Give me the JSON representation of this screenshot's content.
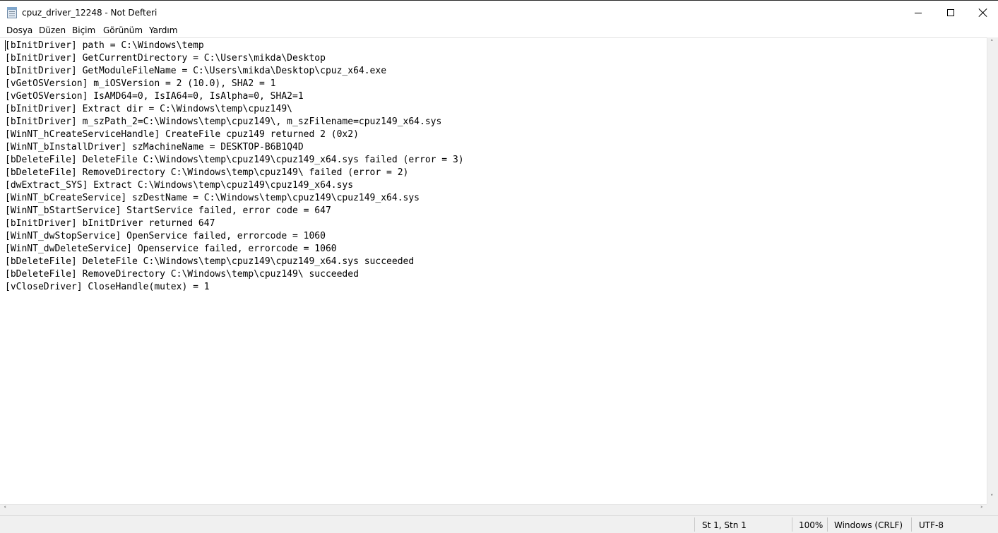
{
  "window": {
    "title": "cpuz_driver_12248 - Not Defteri",
    "app_icon": "notepad-icon"
  },
  "menu": [
    "Dosya",
    "Düzen",
    "Biçim",
    "Görünüm",
    "Yardım"
  ],
  "editor": {
    "lines": [
      "[bInitDriver] path = C:\\Windows\\temp",
      "[bInitDriver] GetCurrentDirectory = C:\\Users\\mikda\\Desktop",
      "[bInitDriver] GetModuleFileName = C:\\Users\\mikda\\Desktop\\cpuz_x64.exe",
      "[vGetOSVersion] m_iOSVersion = 2 (10.0), SHA2 = 1",
      "[vGetOSVersion] IsAMD64=0, IsIA64=0, IsAlpha=0, SHA2=1",
      "[bInitDriver] Extract dir = C:\\Windows\\temp\\cpuz149\\",
      "[bInitDriver] m_szPath_2=C:\\Windows\\temp\\cpuz149\\, m_szFilename=cpuz149_x64.sys",
      "[WinNT_hCreateServiceHandle] CreateFile cpuz149 returned 2 (0x2)",
      "[WinNT_bInstallDriver] szMachineName = DESKTOP-B6B1Q4D",
      "[bDeleteFile] DeleteFile C:\\Windows\\temp\\cpuz149\\cpuz149_x64.sys failed (error = 3)",
      "[bDeleteFile] RemoveDirectory C:\\Windows\\temp\\cpuz149\\ failed (error = 2)",
      "[dwExtract_SYS] Extract C:\\Windows\\temp\\cpuz149\\cpuz149_x64.sys",
      "[WinNT_bCreateService] szDestName = C:\\Windows\\temp\\cpuz149\\cpuz149_x64.sys",
      "[WinNT_bStartService] StartService failed, error code = 647",
      "[bInitDriver] bInitDriver returned 647",
      "[WinNT_dwStopService] OpenService failed, errorcode = 1060",
      "[WinNT_dwDeleteService] Openservice failed, errorcode = 1060",
      "[bDeleteFile] DeleteFile C:\\Windows\\temp\\cpuz149\\cpuz149_x64.sys succeeded",
      "[bDeleteFile] RemoveDirectory C:\\Windows\\temp\\cpuz149\\ succeeded",
      "[vCloseDriver] CloseHandle(mutex) = 1"
    ]
  },
  "statusbar": {
    "position": "St 1, Stn 1",
    "zoom": "100%",
    "line_ending": "Windows (CRLF)",
    "encoding": "UTF-8"
  }
}
